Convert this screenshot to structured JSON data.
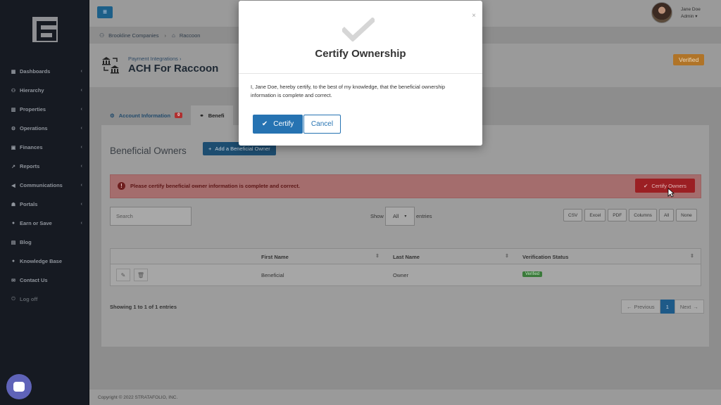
{
  "sidebar": {
    "items": [
      {
        "label": "Dashboards",
        "icon": "dashboard-icon",
        "chevron": true
      },
      {
        "label": "Hierarchy",
        "icon": "hierarchy-icon",
        "chevron": true
      },
      {
        "label": "Properties",
        "icon": "properties-icon",
        "chevron": true
      },
      {
        "label": "Operations",
        "icon": "operations-icon",
        "chevron": true
      },
      {
        "label": "Finances",
        "icon": "finances-icon",
        "chevron": true
      },
      {
        "label": "Reports",
        "icon": "reports-icon",
        "chevron": true
      },
      {
        "label": "Communications",
        "icon": "megaphone-icon",
        "chevron": true
      },
      {
        "label": "Portals",
        "icon": "portals-icon",
        "chevron": true
      },
      {
        "label": "Earn or Save",
        "icon": "piggy-bank-icon",
        "chevron": true
      },
      {
        "label": "Blog",
        "icon": "blog-icon",
        "chevron": false
      },
      {
        "label": "Knowledge Base",
        "icon": "knowledge-icon",
        "chevron": false
      },
      {
        "label": "Contact Us",
        "icon": "envelope-icon",
        "chevron": false
      },
      {
        "label": "Log off",
        "icon": "power-icon",
        "chevron": false
      }
    ]
  },
  "topbar": {
    "user_name": "Jane Doe",
    "user_role": "Admin ▾"
  },
  "breadcrumb": {
    "company": "Brookline Companies",
    "property": "Raccoon"
  },
  "header": {
    "subtitle": "Payment Integrations  ›",
    "title": "ACH For Raccoon",
    "status": "Verified"
  },
  "tabs": [
    {
      "label": "Account Information",
      "badge": "0"
    },
    {
      "label": "Benefi"
    }
  ],
  "beneficial": {
    "title": "Beneficial Owners",
    "add_label": "Add a Beneficial Owner",
    "alert_text": "Please certify beneficial owner information is complete and correct.",
    "certify_owners_label": "Certify Owners",
    "search_placeholder": "Search",
    "show_label": "Show",
    "show_value": "All",
    "entries_label": "entries",
    "exports": [
      "CSV",
      "Excel",
      "PDF",
      "Columns",
      "All",
      "None"
    ],
    "columns": [
      "First Name",
      "Last Name",
      "Verification Status"
    ],
    "rows": [
      {
        "first_name": "Beneficial",
        "last_name": "Owner",
        "status": "Verified"
      }
    ],
    "showing": "Showing 1 to 1 of 1 entries",
    "pager": {
      "previous": "Previous",
      "current": "1",
      "next": "Next"
    }
  },
  "footer": {
    "copyright": "Copyright © 2022 STRATAFOLIO, INC."
  },
  "modal": {
    "title": "Certify Ownership",
    "text": "I, Jane Doe, hereby certify, to the best of my knowledge, that the beneficial ownership information is complete and correct.",
    "certify_label": "Certify",
    "cancel_label": "Cancel",
    "close": "×"
  },
  "colors": {
    "primary": "#2673b2",
    "danger": "#9b1f23",
    "verified_badge": "#3b7a3b",
    "header_verified": "#b07428",
    "sidebar_bg": "#161a22"
  }
}
